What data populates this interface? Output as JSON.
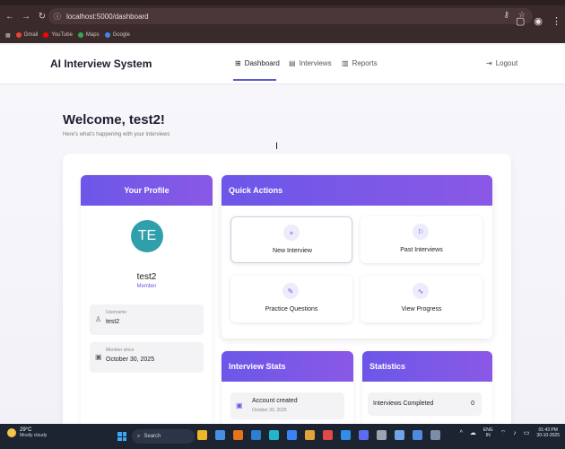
{
  "browser": {
    "url": "localhost:5000/dashboard",
    "bookmarks": [
      {
        "label": "Gmail",
        "color": "#ea4335"
      },
      {
        "label": "YouTube",
        "color": "#ff0000"
      },
      {
        "label": "Maps",
        "color": "#34a853"
      },
      {
        "label": "Google",
        "color": "#4285f4"
      }
    ]
  },
  "header": {
    "brand": "AI Interview System",
    "nav": [
      {
        "label": "Dashboard",
        "icon": "grid-icon"
      },
      {
        "label": "Interviews",
        "icon": "document-icon"
      },
      {
        "label": "Reports",
        "icon": "report-icon"
      }
    ],
    "logout": "Logout"
  },
  "welcome": {
    "title": "Welcome, test2!",
    "subtitle": "Here's what's happening with your interviews"
  },
  "profile": {
    "heading": "Your Profile",
    "initials": "TE",
    "name": "test2",
    "role": "Member",
    "username_label": "Username",
    "username": "test2",
    "member_since_label": "Member since",
    "member_since": "October 30, 2025"
  },
  "quick_actions": {
    "heading": "Quick Actions",
    "items": [
      {
        "label": "New Interview",
        "icon": "plus-icon"
      },
      {
        "label": "Past Interviews",
        "icon": "flag-icon"
      },
      {
        "label": "Practice Questions",
        "icon": "pencil-icon"
      },
      {
        "label": "View Progress",
        "icon": "pulse-icon"
      }
    ]
  },
  "interview_stats": {
    "heading": "Interview Stats",
    "item_label": "Account created",
    "item_date": "October 30, 2025"
  },
  "statistics": {
    "heading": "Statistics",
    "item_label": "Interviews Completed",
    "item_value": "0"
  },
  "taskbar": {
    "temperature": "29°C",
    "weather": "Mostly cloudy",
    "search": "Search",
    "lang1": "ENG",
    "lang2": "IN",
    "time": "01:43 PM",
    "date": "30-10-2025"
  }
}
